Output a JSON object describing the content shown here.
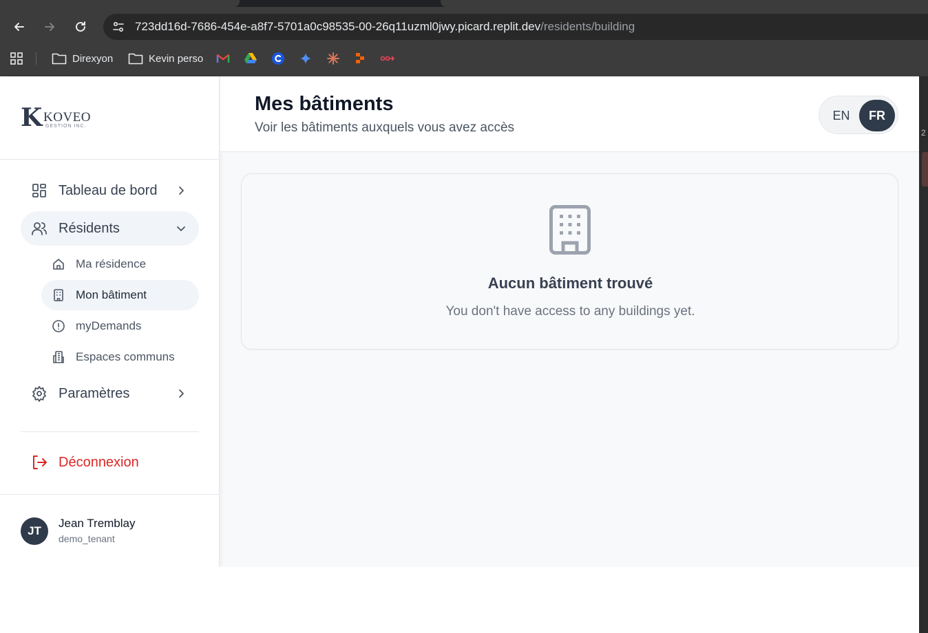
{
  "browser": {
    "url_host": "723dd16d-7686-454e-a8f7-5701a0c98535-00-26q11uzml0jwy.picard.replit.dev",
    "url_path": "/residents/building",
    "bookmarks": [
      {
        "label": "Direxyon",
        "icon": "folder-icon"
      },
      {
        "label": "Kevin perso",
        "icon": "folder-icon"
      }
    ],
    "edge_num": "2"
  },
  "logo": {
    "letter": "K",
    "name": "KOVEO",
    "sub": "GESTION INC."
  },
  "nav": {
    "dashboard": "Tableau de bord",
    "residents": "Résidents",
    "my_residence": "Ma résidence",
    "my_building": "Mon bâtiment",
    "my_demands": "myDemands",
    "common_spaces": "Espaces communs",
    "settings": "Paramètres",
    "logout": "Déconnexion"
  },
  "user": {
    "initials": "JT",
    "name": "Jean Tremblay",
    "role": "demo_tenant"
  },
  "header": {
    "title": "Mes bâtiments",
    "subtitle": "Voir les bâtiments auxquels vous avez accès",
    "lang_en": "EN",
    "lang_fr": "FR",
    "active_lang": "FR"
  },
  "empty_state": {
    "title": "Aucun bâtiment trouvé",
    "description": "You don't have access to any buildings yet.",
    "icon": "building-icon"
  },
  "colors": {
    "accent": "#2f3a4a",
    "danger": "#dc2626"
  }
}
